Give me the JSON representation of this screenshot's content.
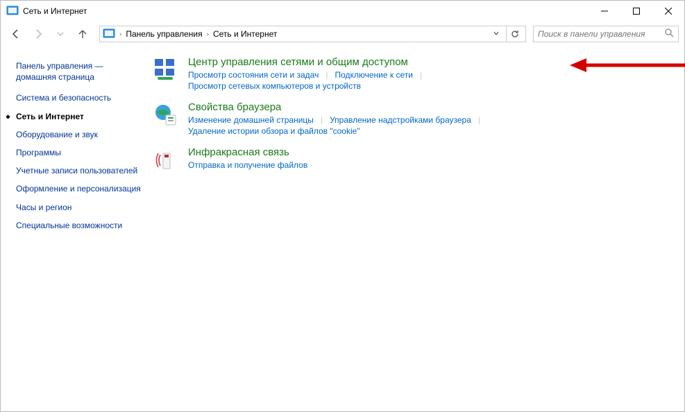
{
  "window": {
    "title": "Сеть и Интернет"
  },
  "breadcrumb": {
    "root": "Панель управления",
    "current": "Сеть и Интернет"
  },
  "search": {
    "placeholder": "Поиск в панели управления"
  },
  "sidebar": {
    "home_line1": "Панель управления —",
    "home_line2": "домашняя страница",
    "categories": [
      {
        "label": "Система и безопасность",
        "active": false
      },
      {
        "label": "Сеть и Интернет",
        "active": true
      },
      {
        "label": "Оборудование и звук",
        "active": false
      },
      {
        "label": "Программы",
        "active": false
      },
      {
        "label": "Учетные записи пользователей",
        "active": false
      },
      {
        "label": "Оформление и персонализация",
        "active": false
      },
      {
        "label": "Часы и регион",
        "active": false
      },
      {
        "label": "Специальные возможности",
        "active": false
      }
    ]
  },
  "sections": [
    {
      "title": "Центр управления сетями и общим доступом",
      "links_row1": [
        "Просмотр состояния сети и задач",
        "Подключение к сети"
      ],
      "links_row2": [
        "Просмотр сетевых компьютеров и устройств"
      ]
    },
    {
      "title": "Свойства браузера",
      "links_row1": [
        "Изменение домашней страницы",
        "Управление надстройками браузера"
      ],
      "links_row2": [
        "Удаление истории обзора и файлов \"cookie\""
      ]
    },
    {
      "title": "Инфракрасная связь",
      "links_row1": [
        "Отправка и получение файлов"
      ],
      "links_row2": []
    }
  ]
}
